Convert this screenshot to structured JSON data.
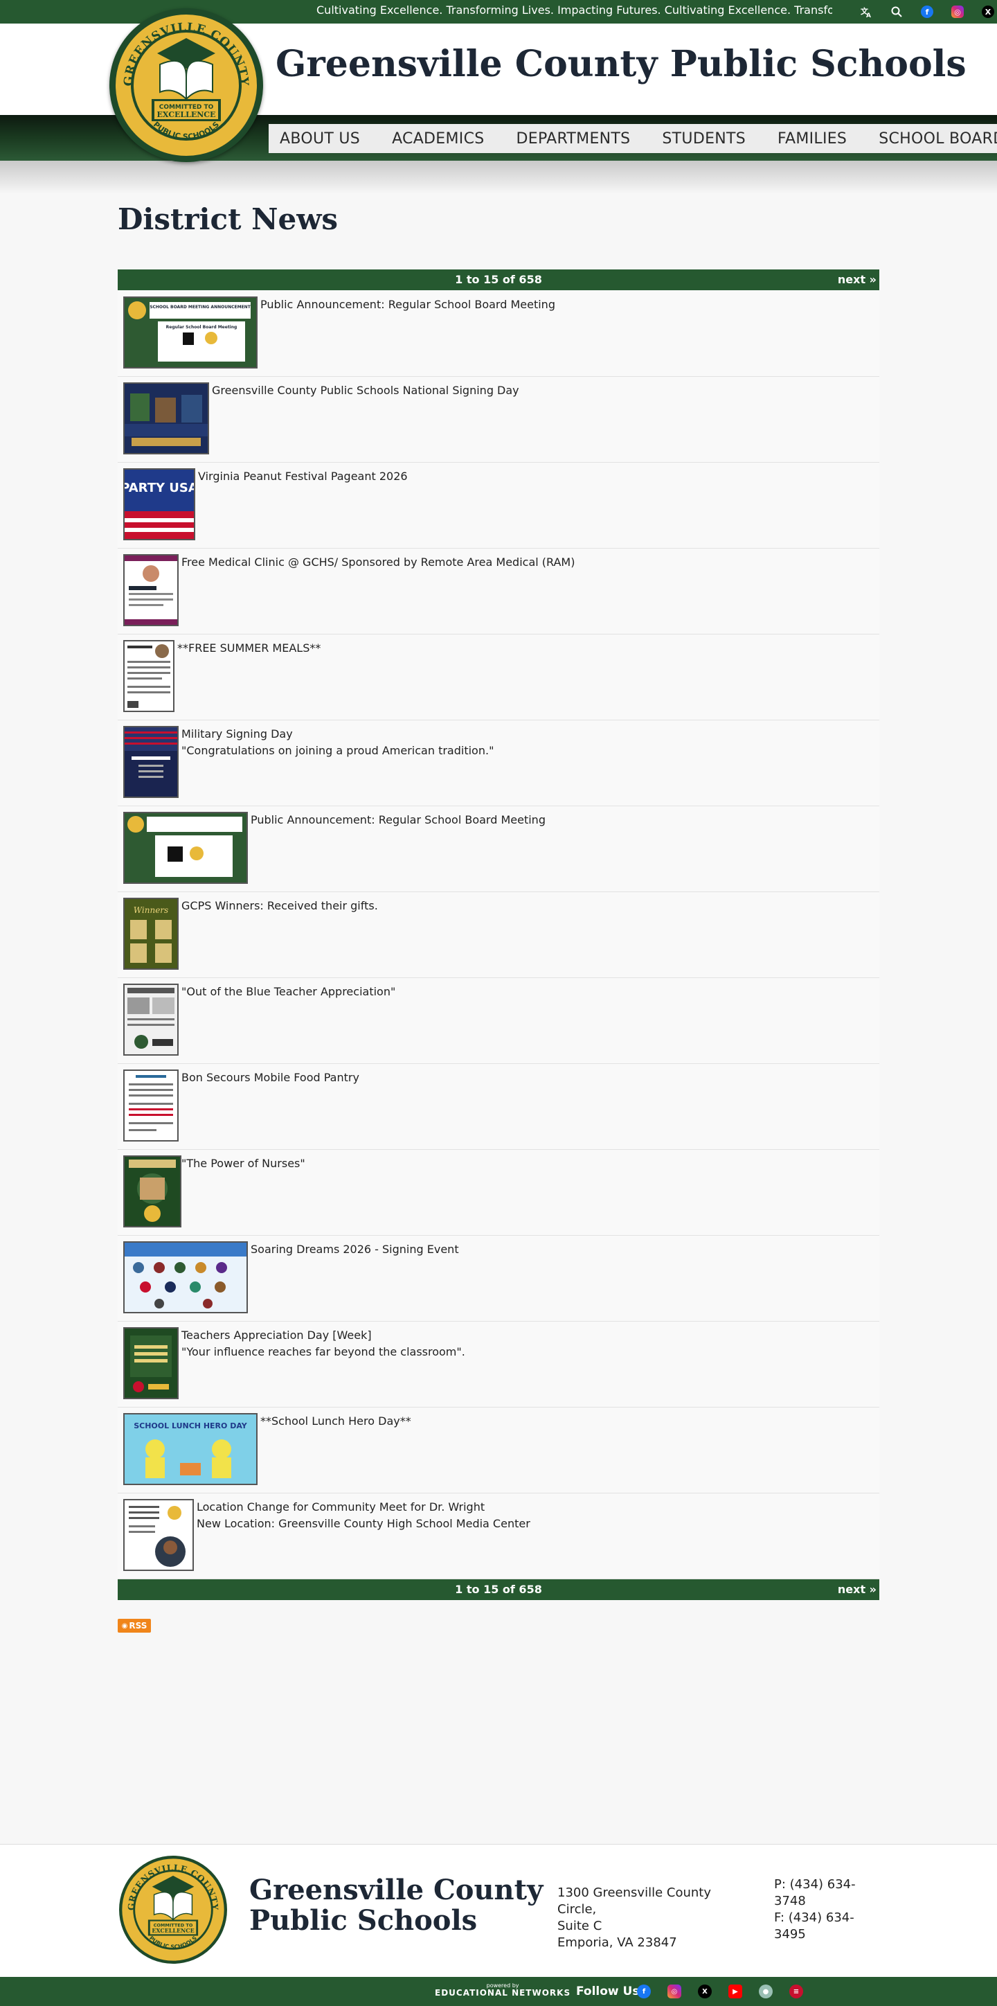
{
  "topbar": {
    "ticker_text": "Cultivating Excellence. Transforming Lives. Impacting Futures.  Cultivating Excellence. Transforming Lives. Impacting Future",
    "icons": [
      "translate-icon",
      "search-icon",
      "facebook-icon",
      "instagram-icon",
      "x-icon"
    ]
  },
  "header": {
    "site_title": "Greensville County Public Schools",
    "seal_top_text": "GREENSVILLE COUNTY",
    "seal_banner_1": "COMMITTED TO",
    "seal_banner_2": "EXCELLENCE",
    "seal_bottom_text": "PUBLIC SCHOOLS"
  },
  "nav": {
    "items": [
      "ABOUT US",
      "ACADEMICS",
      "DEPARTMENTS",
      "STUDENTS",
      "FAMILIES",
      "SCHOOL BOARD"
    ]
  },
  "main": {
    "heading": "District News",
    "pager": {
      "count": "1 to 15 of 658",
      "next": "next »"
    },
    "items": [
      {
        "title": "Public Announcement: Regular School Board Meeting",
        "sub": ""
      },
      {
        "title": "Greensville County Public Schools National Signing Day",
        "sub": ""
      },
      {
        "title": "Virginia Peanut Festival Pageant 2026",
        "sub": ""
      },
      {
        "title": "Free Medical Clinic @ GCHS/ Sponsored by Remote Area Medical (RAM)",
        "sub": ""
      },
      {
        "title": "**FREE SUMMER MEALS**",
        "sub": ""
      },
      {
        "title": "Military Signing Day",
        "sub": "\"Congratulations on joining a proud American tradition.\""
      },
      {
        "title": "Public Announcement: Regular School Board Meeting",
        "sub": ""
      },
      {
        "title": "GCPS Winners: Received their gifts.",
        "sub": ""
      },
      {
        "title": "\"Out of the Blue Teacher Appreciation\"",
        "sub": ""
      },
      {
        "title": "Bon Secours Mobile Food Pantry",
        "sub": ""
      },
      {
        "title": " \"The Power of Nurses\"",
        "sub": ""
      },
      {
        "title": "Soaring Dreams 2026 - Signing Event",
        "sub": ""
      },
      {
        "title": "Teachers Appreciation Day [Week]",
        "sub": "\"Your influence reaches far beyond the classroom\"."
      },
      {
        "title": "**School Lunch Hero Day**",
        "sub": ""
      },
      {
        "title": "Location Change for Community Meet for Dr. Wright",
        "sub": "New Location: Greensville County High School Media Center"
      }
    ],
    "thumb_texts": {
      "t0_head": "SCHOOL BOARD MEETING ANNOUNCEMENT",
      "t0_body": "Regular School Board Meeting",
      "t2": "PARTY USA",
      "t7": "Winners",
      "t13": "SCHOOL LUNCH HERO DAY"
    },
    "rss_label": "RSS"
  },
  "footer": {
    "title_line1": "Greensville County",
    "title_line2": "Public Schools",
    "address_line1": "1300 Greensville County Circle,",
    "address_line2": "Suite C",
    "address_line3": "Emporia, VA 23847",
    "phone": "P: (434) 634-3748",
    "fax": "F: (434) 634-3495",
    "powered_small": "powered by",
    "powered_brand": "EDUCATIONAL NETWORKS",
    "follow_label": "Follow Us:",
    "social_icons": [
      "facebook-icon",
      "instagram-icon",
      "x-icon",
      "youtube-icon",
      "peachjar-icon",
      "flag-icon"
    ]
  },
  "colors": {
    "brand_green": "#265930",
    "title_navy": "#1d2735",
    "seal_gold": "#e8b93a",
    "rss_orange": "#f0851a"
  }
}
